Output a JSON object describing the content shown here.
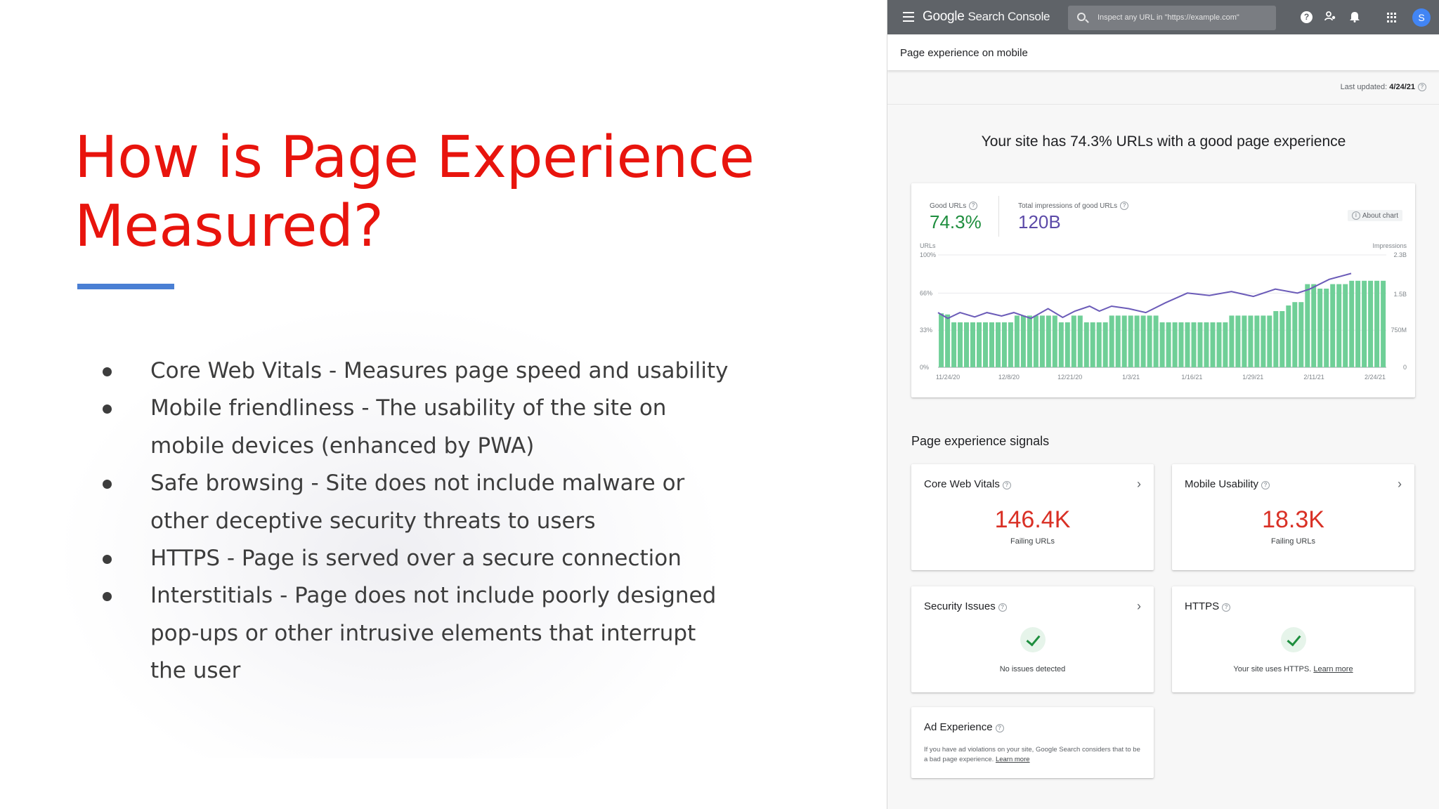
{
  "slide": {
    "title": "How is Page Experience Measured?",
    "bullets": [
      "Core Web Vitals - Measures page speed and usability",
      "Mobile friendliness - The usability of the site on mobile devices (enhanced by PWA)",
      "Safe browsing - Site does not include malware or other deceptive security threats to users",
      "HTTPS - Page is served over a secure connection",
      "Interstitials - Page does not include poorly designed pop-ups or other intrusive elements that interrupt the user"
    ],
    "colors": {
      "title": "#e8140d",
      "rule": "#4a7fd4",
      "text": "#3d3d3d"
    }
  },
  "gsc": {
    "topbar": {
      "logo_part1": "Google",
      "logo_part2": "Search Console",
      "search_placeholder": "Inspect any URL in \"https://example.com\"",
      "avatar_initial": "S",
      "icons": [
        "menu-icon",
        "search-icon",
        "help-icon",
        "users-icon",
        "bell-icon",
        "apps-icon"
      ]
    },
    "page_name": "Page experience on mobile",
    "last_updated_label": "Last updated:",
    "last_updated_value": "4/24/21",
    "summary": "Your site has 74.3% URLs with a good page experience",
    "metrics": {
      "good_urls_label": "Good URLs",
      "good_urls_value": "74.3%",
      "impressions_label": "Total impressions of good URLs",
      "impressions_value": "120B",
      "about_chart": "About chart"
    },
    "signals_title": "Page experience signals",
    "signals": {
      "cwv": {
        "title": "Core Web Vitals",
        "value": "146.4K",
        "caption": "Failing URLs"
      },
      "mobile": {
        "title": "Mobile Usability",
        "value": "18.3K",
        "caption": "Failing URLs"
      },
      "security": {
        "title": "Security Issues",
        "caption": "No issues detected"
      },
      "https": {
        "title": "HTTPS",
        "caption": "Your site uses HTTPS.",
        "link": "Learn more"
      },
      "ad": {
        "title": "Ad Experience",
        "caption": "If you have ad violations on your site, Google Search considers that to be a bad page experience.",
        "link": "Learn more"
      }
    },
    "colors": {
      "good_green": "#1e8e3e",
      "impressions_purple": "#5c4aa8",
      "failing_red": "#d93025",
      "bar_green": "#6fcf97",
      "line_purple": "#6b5bb8"
    }
  },
  "chart_data": {
    "type": "bar",
    "title": "",
    "left_axis_label": "URLs",
    "right_axis_label": "Impressions",
    "left_ticks": [
      "100%",
      "66%",
      "33%",
      "0%"
    ],
    "right_ticks": [
      "2.3B",
      "1.5B",
      "750M",
      "0"
    ],
    "x_ticks": [
      "11/24/20",
      "12/8/20",
      "12/21/20",
      "1/3/21",
      "1/16/21",
      "1/29/21",
      "2/11/21",
      "2/24/21"
    ],
    "ylim_left": [
      0,
      100
    ],
    "ylim_right": [
      0,
      2.3
    ],
    "series": [
      {
        "name": "Good URLs",
        "axis": "left",
        "values": [
          48,
          47,
          40,
          40,
          40,
          40,
          40,
          40,
          40,
          40,
          40,
          40,
          46,
          46,
          46,
          46,
          46,
          46,
          46,
          40,
          40,
          46,
          46,
          40,
          40,
          40,
          40,
          46,
          46,
          46,
          46,
          46,
          46,
          46,
          46,
          40,
          40,
          40,
          40,
          40,
          40,
          40,
          40,
          40,
          40,
          40,
          46,
          46,
          46,
          46,
          46,
          46,
          46,
          50,
          50,
          55,
          58,
          58,
          74,
          74,
          70,
          70,
          74,
          74,
          74,
          77,
          77,
          77,
          77,
          77,
          77
        ]
      },
      {
        "name": "Total impressions of good URLs",
        "axis": "right",
        "points": [
          [
            0,
            1.12
          ],
          [
            4,
            1.0
          ],
          [
            9,
            1.12
          ],
          [
            15,
            1.03
          ],
          [
            20,
            1.12
          ],
          [
            26,
            1.05
          ],
          [
            31,
            1.12
          ],
          [
            38,
            1.0
          ],
          [
            45,
            1.2
          ],
          [
            51,
            1.02
          ],
          [
            56,
            1.15
          ],
          [
            62,
            1.25
          ],
          [
            66,
            1.15
          ],
          [
            71,
            1.25
          ],
          [
            78,
            1.2
          ],
          [
            85,
            1.12
          ],
          [
            93,
            1.32
          ],
          [
            102,
            1.52
          ],
          [
            111,
            1.47
          ],
          [
            120,
            1.55
          ],
          [
            129,
            1.45
          ],
          [
            138,
            1.6
          ],
          [
            147,
            1.52
          ],
          [
            152,
            1.6
          ],
          [
            160,
            1.8
          ],
          [
            169,
            1.92
          ]
        ]
      }
    ],
    "grid": true
  }
}
